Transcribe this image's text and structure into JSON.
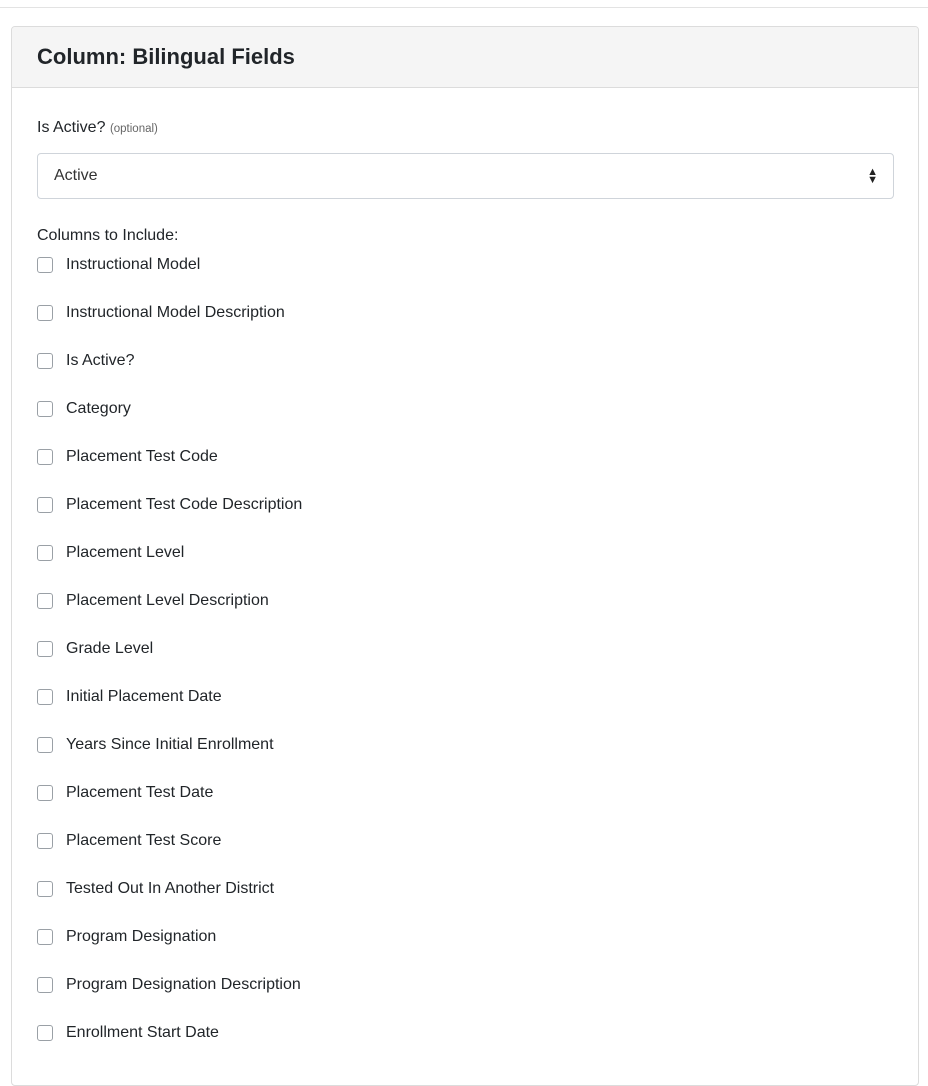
{
  "panel": {
    "title": "Column: Bilingual Fields"
  },
  "is_active": {
    "label": "Is Active?",
    "optional_note": "(optional)",
    "selected": "Active"
  },
  "columns": {
    "label": "Columns to Include:",
    "items": [
      {
        "label": "Instructional Model",
        "checked": false
      },
      {
        "label": "Instructional Model Description",
        "checked": false
      },
      {
        "label": "Is Active?",
        "checked": false
      },
      {
        "label": "Category",
        "checked": false
      },
      {
        "label": "Placement Test Code",
        "checked": false
      },
      {
        "label": "Placement Test Code Description",
        "checked": false
      },
      {
        "label": "Placement Level",
        "checked": false
      },
      {
        "label": "Placement Level Description",
        "checked": false
      },
      {
        "label": "Grade Level",
        "checked": false
      },
      {
        "label": "Initial Placement Date",
        "checked": false
      },
      {
        "label": "Years Since Initial Enrollment",
        "checked": false
      },
      {
        "label": "Placement Test Date",
        "checked": false
      },
      {
        "label": "Placement Test Score",
        "checked": false
      },
      {
        "label": "Tested Out In Another District",
        "checked": false
      },
      {
        "label": "Program Designation",
        "checked": false
      },
      {
        "label": "Program Designation Description",
        "checked": false
      },
      {
        "label": "Enrollment Start Date",
        "checked": false
      }
    ]
  }
}
